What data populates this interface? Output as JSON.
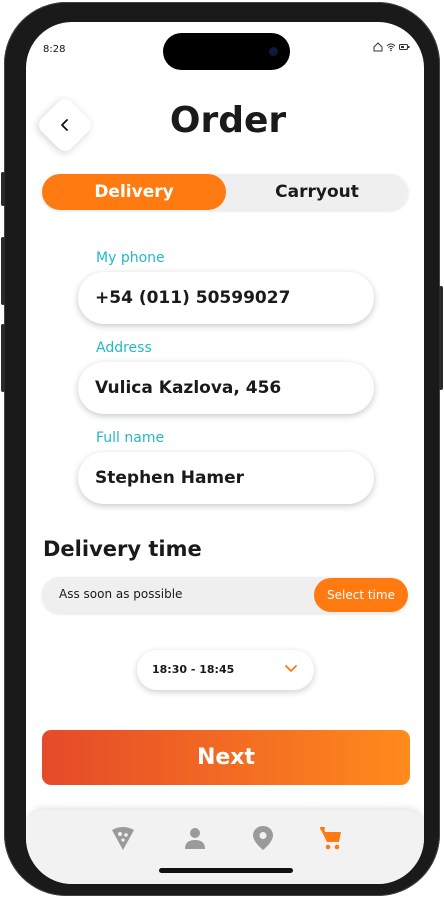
{
  "status_bar": {
    "time": "8:28",
    "icons": [
      "home-icon",
      "wifi-icon",
      "battery-icon"
    ]
  },
  "header": {
    "title": "Order",
    "back_icon": "chevron-left-icon"
  },
  "tabs": [
    {
      "label": "Delivery",
      "active": true
    },
    {
      "label": "Carryout",
      "active": false
    }
  ],
  "form": {
    "phone_label": "My phone",
    "phone_value": "+54 (011) 50599027",
    "address_label": "Address",
    "address_value": "Vulica Kazlova, 456",
    "name_label": "Full name",
    "name_value": "Stephen Hamer"
  },
  "delivery_time": {
    "title": "Delivery time",
    "asap_label": "Ass soon as possible",
    "select_label": "Select time",
    "selected_slot": "18:30 - 18:45"
  },
  "actions": {
    "next_label": "Next"
  },
  "bottom_nav": {
    "items": [
      "pizza-icon",
      "user-icon",
      "location-pin-icon",
      "cart-icon"
    ],
    "active": "cart-icon"
  },
  "colors": {
    "accent": "#ff7a10",
    "label_teal": "#22b8c8",
    "inactive_icon": "#9a9a9a",
    "gradient_start": "#e54a2a",
    "gradient_end": "#ff8a1c"
  }
}
